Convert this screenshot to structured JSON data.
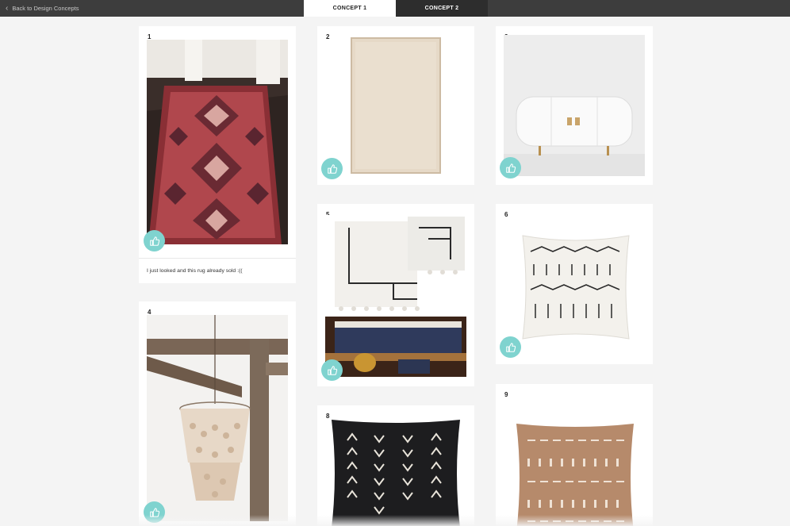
{
  "nav": {
    "back_label": "Back to Design Concepts",
    "tabs": [
      {
        "label": "CONCEPT 1",
        "active": true
      },
      {
        "label": "CONCEPT 2",
        "active": false
      }
    ]
  },
  "colors": {
    "accent": "#7fd3cf",
    "topbar": "#3d3d3d"
  },
  "items": [
    {
      "number": "1",
      "subject": "red vintage runner rug",
      "comment": "I just looked and this rug already sold :(("
    },
    {
      "number": "2",
      "subject": "natural jute rug"
    },
    {
      "number": "3",
      "subject": "white lacquer sideboard"
    },
    {
      "number": "4",
      "subject": "capiz shell chandelier"
    },
    {
      "number": "5",
      "subject": "white tassel throw blanket"
    },
    {
      "number": "6",
      "subject": "mudcloth throw pillow"
    },
    {
      "number": "8",
      "subject": "black mudcloth pillow"
    },
    {
      "number": "9",
      "subject": "rust mudcloth pillow"
    }
  ]
}
